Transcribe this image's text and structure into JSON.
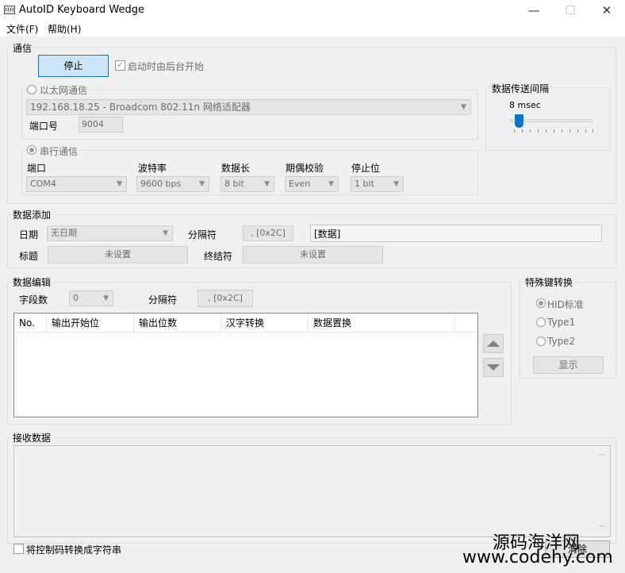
{
  "window": {
    "title": "AutoID Keyboard Wedge",
    "minimize": "—",
    "maximize": "☐",
    "close": "✕"
  },
  "menu": {
    "file": "文件(F)",
    "help": "帮助(H)"
  },
  "comm": {
    "label": "通信",
    "stop_button": "停止",
    "autostart_label": "启动时由后台开始",
    "autostart_checked": true,
    "ethernet": {
      "label": "以太网通信",
      "adapter": "192.168.18.25 - Broadcom 802.11n 网络适配器",
      "port_label": "端口号",
      "port_value": "9004"
    },
    "serial": {
      "label": "串行通信",
      "port_label": "端口",
      "port_value": "COM4",
      "baud_label": "波特率",
      "baud_value": "9600 bps",
      "data_len_label": "数据长",
      "data_len_value": "8 bit",
      "parity_label": "期偶校验",
      "parity_value": "Even",
      "stop_label": "停止位",
      "stop_value": "1 bit"
    }
  },
  "interval": {
    "label": "数据传送间隔",
    "value_text": "8 msec",
    "slider_fraction": 0.06
  },
  "data_add": {
    "label": "数据添加",
    "date_label": "日期",
    "date_value": "无日期",
    "sep_label": "分隔符",
    "sep_value": ", [0x2C]",
    "data_preview": "[数据]",
    "title_label": "标题",
    "title_value": "未设置",
    "terminator_label": "终结符",
    "terminator_value": "未设置"
  },
  "data_edit": {
    "label": "数据编辑",
    "field_count_label": "字段数",
    "field_count_value": "0",
    "sep_label": "分隔符",
    "sep_value": ", [0x2C]",
    "columns": [
      "No.",
      "输出开始位",
      "输出位数",
      "汉字转换",
      "数据置换"
    ]
  },
  "special_key": {
    "label": "特殊键转换",
    "options": [
      "HID标准",
      "Type1",
      "Type2"
    ],
    "selected": "HID标准",
    "show_button": "显示"
  },
  "receive": {
    "label": "接收数据",
    "convert_label": "将控制码转换成字符串",
    "clear_button": "清除"
  },
  "watermark": {
    "line1": "源码海洋网",
    "line2": "www.codehy.com"
  },
  "icons": [
    "keyboard-app-icon",
    "chevron-down-icon",
    "arrow-up-icon",
    "arrow-down-icon",
    "scroll-up-icon",
    "scroll-down-icon"
  ]
}
